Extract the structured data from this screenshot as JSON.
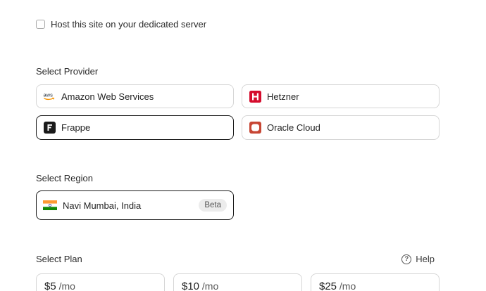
{
  "host": {
    "label": "Host this site on your dedicated server",
    "checked": false
  },
  "provider": {
    "heading": "Select Provider",
    "options": [
      {
        "label": "Amazon Web Services",
        "icon": "aws-logo-icon",
        "selected": false
      },
      {
        "label": "Hetzner",
        "icon": "hetzner-logo-icon",
        "selected": false
      },
      {
        "label": "Frappe",
        "icon": "frappe-logo-icon",
        "selected": true
      },
      {
        "label": "Oracle Cloud",
        "icon": "oracle-logo-icon",
        "selected": false
      }
    ]
  },
  "region": {
    "heading": "Select Region",
    "options": [
      {
        "label": "Navi Mumbai, India",
        "icon": "india-flag-icon",
        "badge": "Beta",
        "selected": true
      }
    ]
  },
  "plan": {
    "heading": "Select Plan",
    "help_label": "Help",
    "options": [
      {
        "price": "$5",
        "per": " /mo"
      },
      {
        "price": "$10",
        "per": " /mo"
      },
      {
        "price": "$25",
        "per": " /mo"
      }
    ]
  },
  "colors": {
    "hetzner": "#d50c2d",
    "oracle": "#c74634",
    "frappe": "#1a1a1a",
    "aws_smile": "#f79400"
  }
}
